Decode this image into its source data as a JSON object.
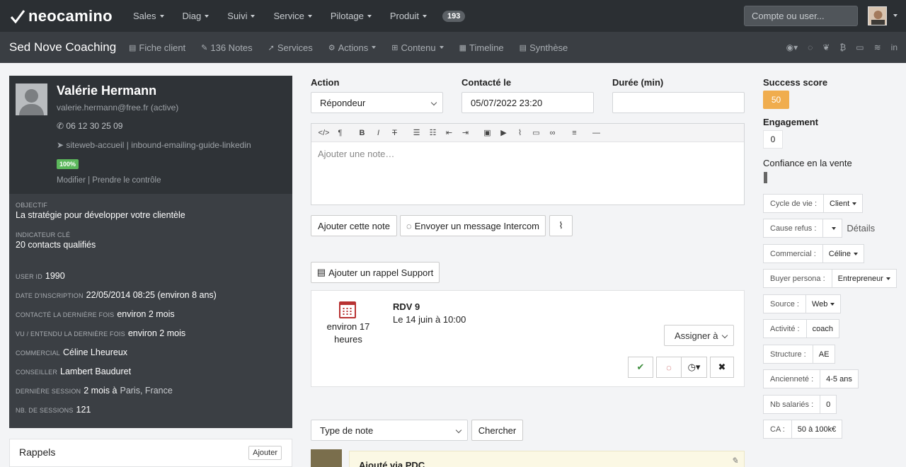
{
  "topbar": {
    "logo": "neocamino",
    "menu": [
      {
        "label": "Sales"
      },
      {
        "label": "Diag"
      },
      {
        "label": "Suivi"
      },
      {
        "label": "Service"
      },
      {
        "label": "Pilotage"
      },
      {
        "label": "Produit"
      }
    ],
    "badge": "193",
    "search_placeholder": "Compte ou user..."
  },
  "subbar": {
    "client": "Sed Nove Coaching",
    "items": [
      {
        "label": "Fiche client",
        "icon": "file-icon"
      },
      {
        "label": "136 Notes",
        "icon": "edit-icon"
      },
      {
        "label": "Services",
        "icon": "rocket-icon"
      },
      {
        "label": "Actions",
        "icon": "cog-icon"
      },
      {
        "label": "Contenu",
        "icon": "sitemap-icon"
      },
      {
        "label": "Timeline",
        "icon": "calendar-icon"
      },
      {
        "label": "Synthèse",
        "icon": "list-icon"
      }
    ]
  },
  "profile": {
    "name": "Valérie Hermann",
    "email": "valerie.hermann@free.fr (active)",
    "phone": "06 12 30 25 09",
    "source": "siteweb-accueil | inbound-emailing-guide-linkedin",
    "percent": "100%",
    "link_edit": "Modifier",
    "link_control": "Prendre le contrôle",
    "objectif_label": "Objectif",
    "objectif": "La stratégie pour développer votre clientèle",
    "kpi_label": "Indicateur clé",
    "kpi": "20 contacts qualifiés",
    "rows": [
      {
        "label": "User ID",
        "value": "1990",
        "extra": ""
      },
      {
        "label": "Date d'inscription",
        "value": "22/05/2014 08:25 (environ 8 ans)",
        "extra": ""
      },
      {
        "label": "Contacté la dernière fois",
        "value": "environ 2 mois",
        "extra": ""
      },
      {
        "label": "Vu / entendu la dernière fois",
        "value": "environ 2 mois",
        "extra": ""
      },
      {
        "label": "Commercial",
        "value": "Céline Lheureux",
        "extra": ""
      },
      {
        "label": "Conseiller",
        "value": "Lambert Bauduret",
        "extra": ""
      },
      {
        "label": "Dernière session",
        "value": "2 mois à",
        "extra": "Paris, France"
      },
      {
        "label": "Nb. de sessions",
        "value": "121",
        "extra": ""
      }
    ]
  },
  "rappels": {
    "title": "Rappels",
    "add": "Ajouter"
  },
  "form": {
    "action_label": "Action",
    "action_value": "Répondeur",
    "contact_label": "Contacté le",
    "contact_value": "05/07/2022 23:20",
    "duration_label": "Durée (min)",
    "duration_value": "",
    "note_placeholder": "Ajouter une note…",
    "add_note": "Ajouter cette note",
    "intercom": "Envoyer un message Intercom",
    "add_reminder": "Ajouter un rappel Support"
  },
  "rdv": {
    "time": "environ 17 heures",
    "title": "RDV 9",
    "date": "Le 14 juin à 10:00",
    "assign": "Assigner à"
  },
  "filter": {
    "type_placeholder": "Type de note",
    "search": "Chercher"
  },
  "note": {
    "title": "Ajouté via PDC"
  },
  "right": {
    "score_label": "Success score",
    "score": "50",
    "engagement_label": "Engagement",
    "engagement": "0",
    "confidence_label": "Confiance en la vente",
    "attributes": [
      {
        "key": "Cycle de vie :",
        "value": "Client",
        "dropdown": true
      },
      {
        "key": "Cause refus :",
        "value": "",
        "dropdown": true,
        "after": "Détails"
      },
      {
        "key": "Commercial :",
        "value": "Céline",
        "dropdown": true
      },
      {
        "key": "Buyer persona :",
        "value": "Entrepreneur",
        "dropdown": true
      },
      {
        "key": "Source :",
        "value": "Web",
        "dropdown": true
      },
      {
        "key": "Activité :",
        "value": "coach",
        "dropdown": false
      },
      {
        "key": "Structure :",
        "value": "AE",
        "dropdown": false
      },
      {
        "key": "Ancienneté :",
        "value": "4-5 ans",
        "dropdown": false
      },
      {
        "key": "Nb salariés :",
        "value": "0",
        "dropdown": false
      },
      {
        "key": "CA :",
        "value": "50 à 100k€",
        "dropdown": false
      }
    ]
  }
}
